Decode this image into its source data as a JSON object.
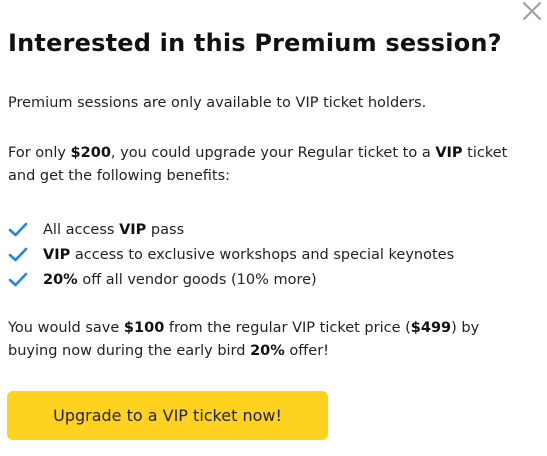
{
  "modal": {
    "title": "Interested in this Premium session?",
    "intro": "Premium sessions are only available to VIP ticket holders.",
    "offer": {
      "prefix": "For only ",
      "price": "$200",
      "middle": ", you could upgrade your Regular ticket to a ",
      "tier": "VIP",
      "suffix": " ticket and get the following benefits:"
    },
    "benefits": [
      {
        "pre": "All access ",
        "bold": "VIP",
        "post": " pass"
      },
      {
        "pre": "",
        "bold": "VIP",
        "post": " access to exclusive workshops and special keynotes"
      },
      {
        "pre": "",
        "bold": "20%",
        "post": " off all vendor goods (10% more)"
      }
    ],
    "savings": {
      "prefix": "You would save ",
      "amount": "$100",
      "middle": " from the regular VIP ticket price (",
      "regular_price": "$499",
      "middle2": ") by buying now during the early bird ",
      "discount": "20%",
      "suffix": " offer!"
    },
    "cta_label": "Upgrade to a VIP ticket now!"
  },
  "colors": {
    "accent_yellow": "#FFD21F",
    "check_blue": "#1E88E5",
    "close_gray": "#9E9E9E"
  },
  "icons": {
    "close": "close-icon",
    "check": "checkmark-icon"
  }
}
